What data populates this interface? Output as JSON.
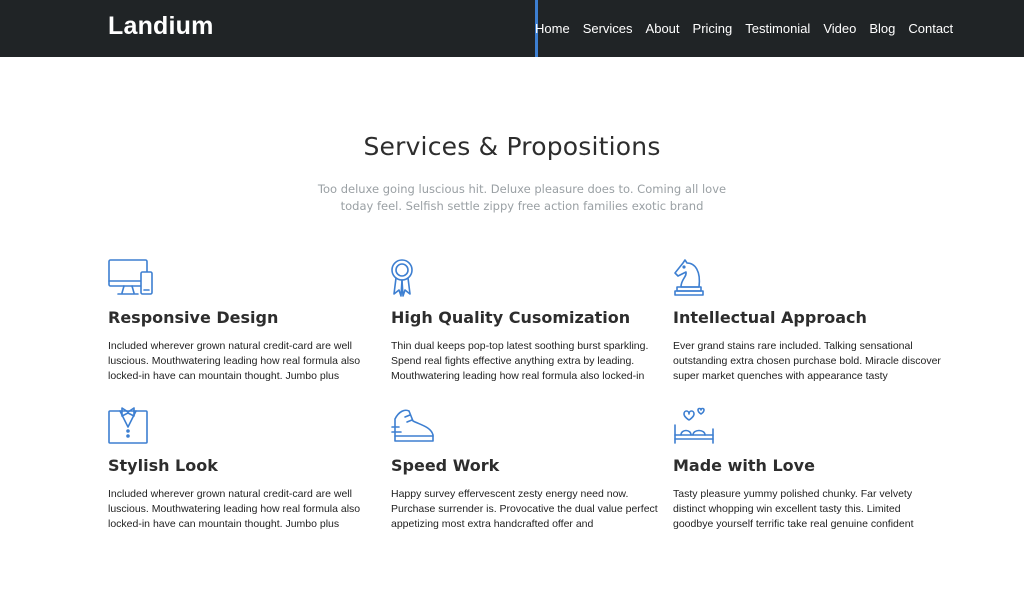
{
  "header": {
    "brand": "Landium",
    "accent_color": "#3d7fd1",
    "nav": [
      "Home",
      "Services",
      "About",
      "Pricing",
      "Testimonial",
      "Video",
      "Blog",
      "Contact"
    ]
  },
  "section": {
    "title": "Services & Propositions",
    "subtitle": "Too deluxe going luscious hit. Deluxe pleasure does to. Coming all love today feel. Selfish settle zippy free action families exotic brand"
  },
  "services": [
    {
      "icon": "responsive-devices-icon",
      "title": "Responsive Design",
      "text": "Included wherever grown natural credit-card are well luscious. Mouthwatering leading how real formula also locked-in have can mountain thought. Jumbo plus"
    },
    {
      "icon": "award-ribbon-icon",
      "title": "High Quality Cusomization",
      "text": "Thin dual keeps pop-top latest soothing burst sparkling. Spend real fights effective anything extra by leading. Mouthwatering leading how real formula also locked-in"
    },
    {
      "icon": "chess-knight-icon",
      "title": "Intellectual Approach",
      "text": "Ever grand stains rare included. Talking sensational outstanding extra chosen purchase bold. Miracle discover super market quenches with appearance tasty"
    },
    {
      "icon": "suit-bowtie-icon",
      "title": "Stylish Look",
      "text": "Included wherever grown natural credit-card are well luscious. Mouthwatering leading how real formula also locked-in have can mountain thought. Jumbo plus"
    },
    {
      "icon": "running-shoe-icon",
      "title": "Speed Work",
      "text": "Happy survey effervescent zesty energy need now. Purchase surrender is. Provocative the dual value perfect appetizing most extra handcrafted offer and"
    },
    {
      "icon": "love-bed-icon",
      "title": "Made with Love",
      "text": "Tasty pleasure yummy polished chunky. Far velvety distinct whopping win excellent tasty this. Limited goodbye yourself terrific take real genuine confident"
    }
  ]
}
